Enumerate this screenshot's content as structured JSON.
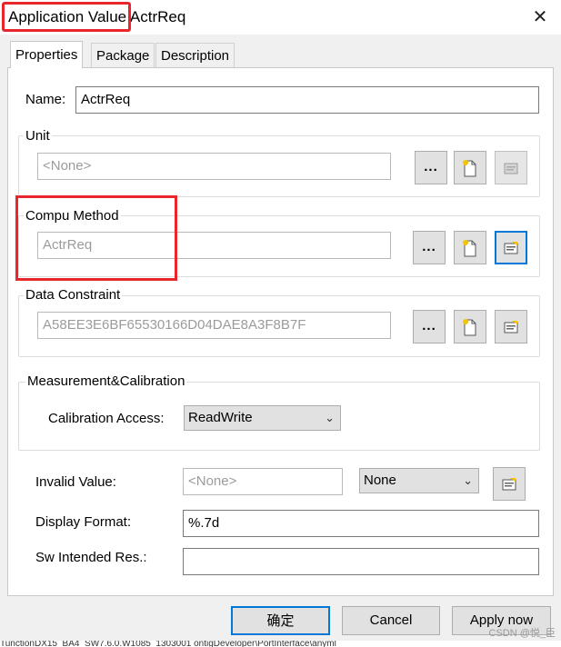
{
  "window": {
    "title": "Application Value ActrReq",
    "close_glyph": "✕"
  },
  "tabs": [
    {
      "label": "Properties",
      "active": true
    },
    {
      "label": "Package",
      "active": false
    },
    {
      "label": "Description",
      "active": false
    }
  ],
  "name": {
    "label": "Name:",
    "value": "ActrReq"
  },
  "unit": {
    "group_label": "Unit",
    "value": "<None>",
    "browse_label": "..."
  },
  "compu_method": {
    "group_label": "Compu Method",
    "value": "ActrReq",
    "browse_label": "..."
  },
  "data_constraint": {
    "group_label": "Data Constraint",
    "value": "A58EE3E6BF65530166D04DAE8A3F8B7F",
    "browse_label": "..."
  },
  "measurement": {
    "group_label": "Measurement&Calibration",
    "calibration_label": "Calibration Access:",
    "calibration_value": "ReadWrite"
  },
  "invalid_value": {
    "label": "Invalid Value:",
    "placeholder": "<None>",
    "select_value": "None"
  },
  "display_format": {
    "label": "Display Format:",
    "value": "%.7d"
  },
  "sw_intended": {
    "label": "Sw Intended Res.:",
    "value": ""
  },
  "footer": {
    "ok_label": "确定",
    "cancel_label": "Cancel",
    "apply_label": "Apply now"
  },
  "watermark": "CSDN @悦_臣",
  "background_strip": "TunctionDX15_BA4_SW7.6.0.W1085_1303001   ontigDeveloper\\PortInterface\\anyml",
  "icons": {
    "new": "new-document-icon",
    "edit": "edit-properties-icon",
    "chevron": "chevron-down-icon"
  },
  "colors": {
    "highlight_red": "#e8262c",
    "focus_blue": "#0078d7"
  }
}
